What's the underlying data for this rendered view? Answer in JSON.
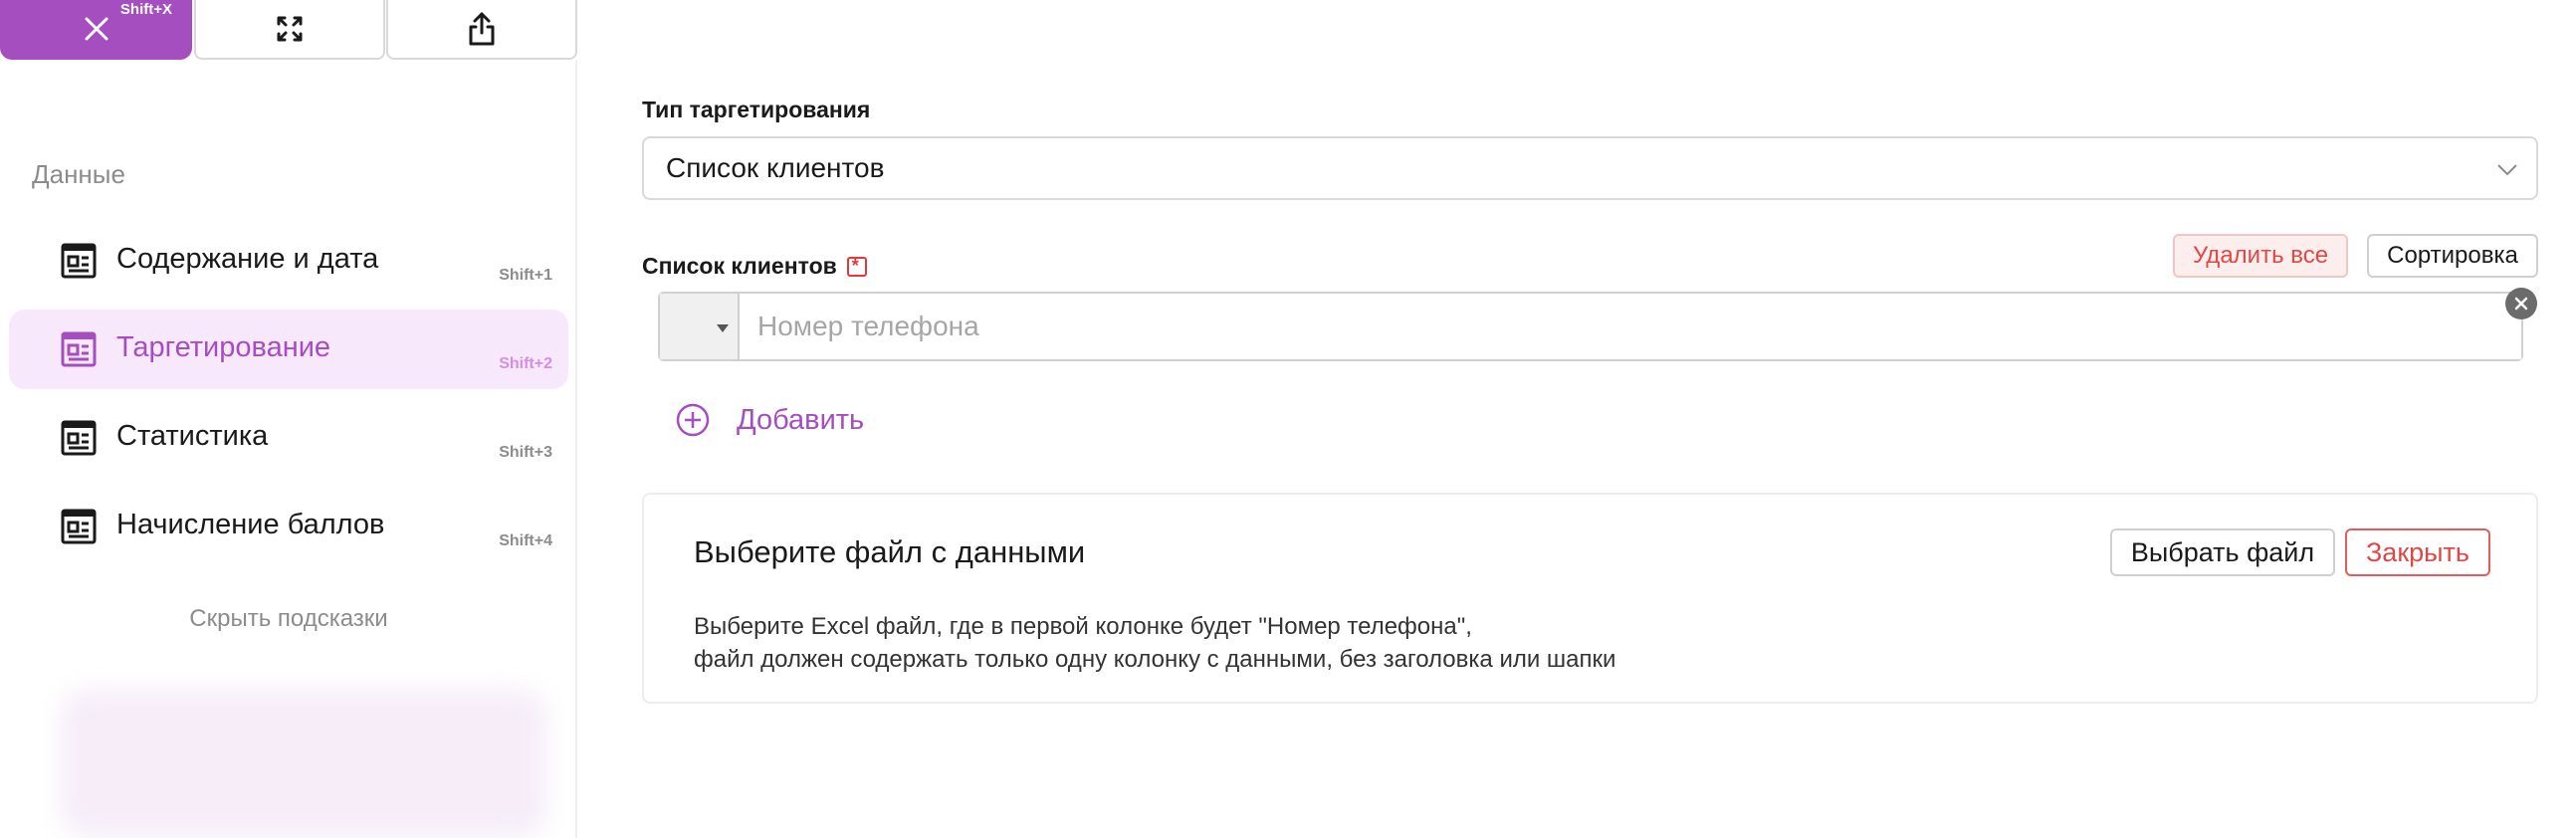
{
  "toolbar": {
    "close_hint": "Shift+X",
    "close_icon": "close-icon",
    "expand_icon": "expand-icon",
    "share_icon": "share-icon"
  },
  "sidebar": {
    "title": "Данные",
    "items": [
      {
        "label": "Содержание и дата",
        "shortcut": "Shift+1",
        "icon": "article-icon",
        "active": false
      },
      {
        "label": "Таргетирование",
        "shortcut": "Shift+2",
        "icon": "article-icon",
        "active": true
      },
      {
        "label": "Статистика",
        "shortcut": "Shift+3",
        "icon": "article-icon",
        "active": false
      },
      {
        "label": "Начисление баллов",
        "shortcut": "Shift+4",
        "icon": "article-icon",
        "active": false
      }
    ],
    "hide_hints": "Скрыть подсказки"
  },
  "main": {
    "targeting_type_label": "Тип таргетирования",
    "targeting_type_value": "Список клиентов",
    "client_list_label": "Список клиентов",
    "delete_all": "Удалить все",
    "sort": "Сортировка",
    "phone_placeholder": "Номер телефона",
    "add_label": "Добавить",
    "file_panel": {
      "title": "Выберите файл с данными",
      "choose_file": "Выбрать файл",
      "close": "Закрыть",
      "desc_line1": "Выберите Excel файл, где в первой колонке будет \"Номер телефона\",",
      "desc_line2": "файл должен содержать только одну колонку с данными, без заголовка или шапки"
    }
  },
  "colors": {
    "accent": "#a54ec0",
    "danger": "#e04848",
    "active_bg": "#f8e8fb"
  }
}
